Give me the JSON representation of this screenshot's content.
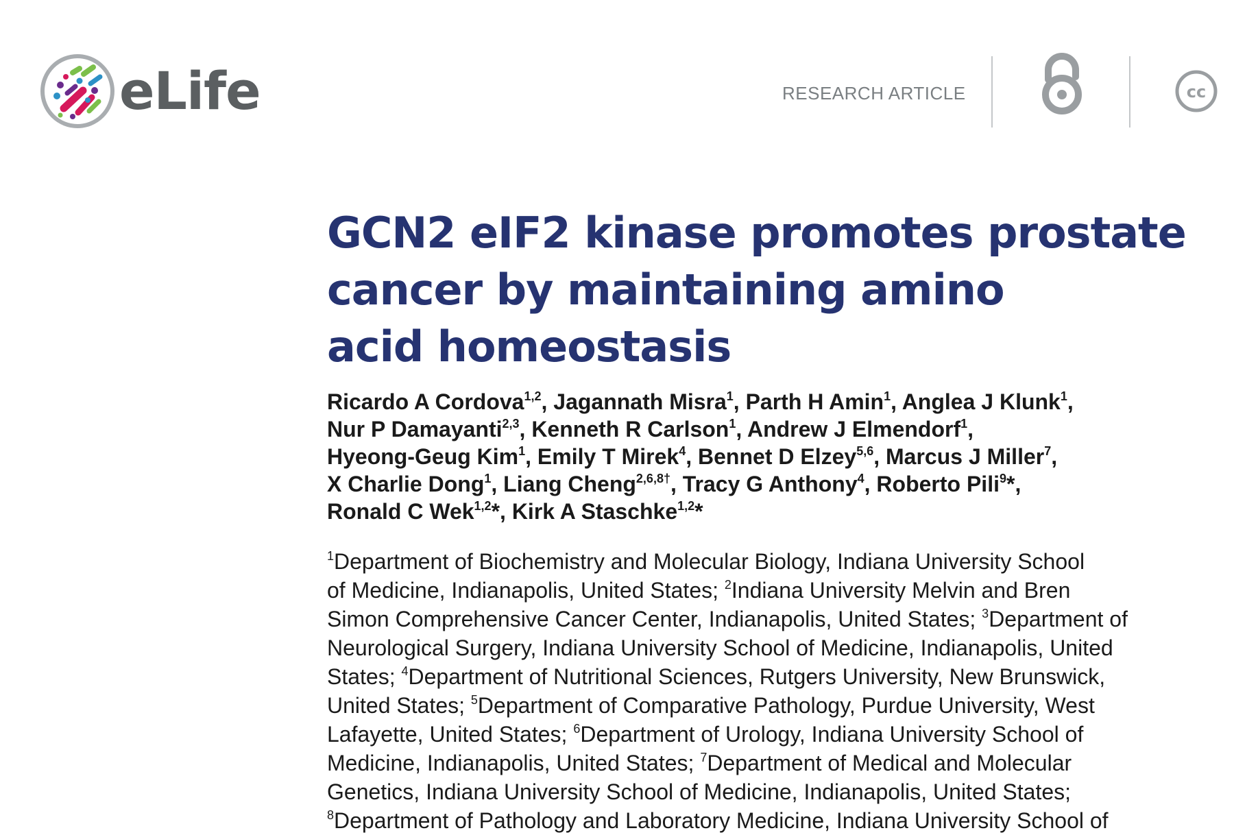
{
  "header": {
    "brand": "eLife",
    "article_type": "RESEARCH ARTICLE",
    "icons": [
      "elife-logo-icon",
      "open-access-icon",
      "creative-commons-icon"
    ]
  },
  "title": {
    "lines": [
      "GCN2 eIF2 kinase promotes prostate",
      "cancer by maintaining amino",
      "acid homeostasis"
    ]
  },
  "authors": {
    "line1": [
      {
        "name": "Ricardo A Cordova",
        "sup": "1,2",
        "sep": ", "
      },
      {
        "name": "Jagannath Misra",
        "sup": "1",
        "sep": ", "
      },
      {
        "name": "Parth H Amin",
        "sup": "1",
        "sep": ", "
      },
      {
        "name": "Anglea J Klunk",
        "sup": "1",
        "sep": ","
      }
    ],
    "line2": [
      {
        "name": "Nur P Damayanti",
        "sup": "2,3",
        "sep": ", "
      },
      {
        "name": "Kenneth R Carlson",
        "sup": "1",
        "sep": ", "
      },
      {
        "name": "Andrew J Elmendorf",
        "sup": "1",
        "sep": ","
      }
    ],
    "line3": [
      {
        "name": "Hyeong-Geug Kim",
        "sup": "1",
        "sep": ", "
      },
      {
        "name": "Emily T Mirek",
        "sup": "4",
        "sep": ", "
      },
      {
        "name": "Bennet D Elzey",
        "sup": "5,6",
        "sep": ", "
      },
      {
        "name": "Marcus J Miller",
        "sup": "7",
        "sep": ","
      }
    ],
    "line4": [
      {
        "name": "X Charlie Dong",
        "sup": "1",
        "sep": ", "
      },
      {
        "name": "Liang Cheng",
        "sup": "2,6,8†",
        "sep": ", "
      },
      {
        "name": "Tracy G Anthony",
        "sup": "4",
        "sep": ", "
      },
      {
        "name": "Roberto Pili",
        "sup": "9",
        "sep": "*,"
      }
    ],
    "line5": [
      {
        "name": "Ronald C Wek",
        "sup": "1,2",
        "sep": "*, "
      },
      {
        "name": "Kirk A Staschke",
        "sup": "1,2",
        "sep": "*"
      }
    ]
  },
  "affiliations": {
    "lines": [
      [
        {
          "sup": "1",
          "text": "Department of Biochemistry and Molecular Biology, Indiana University School"
        }
      ],
      [
        {
          "sup": "",
          "text": "of Medicine, Indianapolis, United States; "
        },
        {
          "sup": "2",
          "text": "Indiana University Melvin and Bren"
        }
      ],
      [
        {
          "sup": "",
          "text": "Simon Comprehensive Cancer Center, Indianapolis, United States; "
        },
        {
          "sup": "3",
          "text": "Department of"
        }
      ],
      [
        {
          "sup": "",
          "text": "Neurological Surgery, Indiana University School of Medicine, Indianapolis, United"
        }
      ],
      [
        {
          "sup": "",
          "text": "States; "
        },
        {
          "sup": "4",
          "text": "Department of Nutritional Sciences, Rutgers University, New Brunswick,"
        }
      ],
      [
        {
          "sup": "",
          "text": "United States; "
        },
        {
          "sup": "5",
          "text": "Department of Comparative Pathology, Purdue University, West"
        }
      ],
      [
        {
          "sup": "",
          "text": "Lafayette, United States; "
        },
        {
          "sup": "6",
          "text": "Department of Urology, Indiana University School of"
        }
      ],
      [
        {
          "sup": "",
          "text": "Medicine, Indianapolis, United States; "
        },
        {
          "sup": "7",
          "text": "Department of Medical and Molecular"
        }
      ],
      [
        {
          "sup": "",
          "text": "Genetics, Indiana University School of Medicine, Indianapolis, United States;"
        }
      ],
      [
        {
          "sup": "8",
          "text": "Department of Pathology and Laboratory Medicine, Indiana University School of"
        }
      ]
    ]
  },
  "colors": {
    "title": "#263371",
    "brand_gray": "#5b5f61",
    "meta_gray": "#7a7f82",
    "divider": "#c4c7c9",
    "body_text": "#1a1a1a"
  }
}
